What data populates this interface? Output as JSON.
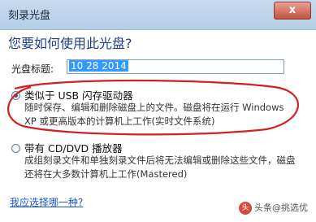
{
  "window": {
    "title": "刻录光盘",
    "close_label": "x"
  },
  "heading": "您要如何使用此光盘?",
  "disc_title": {
    "label": "光盘标题:",
    "value": "10 28 2014"
  },
  "options": [
    {
      "title": "类似于 USB 闪存驱动器",
      "desc_line1": "随时保存、编辑和删除磁盘上的文件。磁盘将在运行 Windows",
      "desc_line2": "XP 或更高版本的计算机上工作(实时文件系统)",
      "selected": true
    },
    {
      "title": "带有 CD/DVD 播放器",
      "desc_line1": "成组刻录文件和单独刻录文件后将无法编辑或删除这些文件，磁盘",
      "desc_line2": "还将在大多数计算机上工作(Mastered)",
      "selected": false
    }
  ],
  "help_link": "我应选择哪一种?",
  "watermark": {
    "text": "头条@挑选优",
    "logo": "头"
  },
  "colors": {
    "heading": "#1f3f86",
    "link": "#1a57c2",
    "annotation": "#d31f1f",
    "selection": "#3399ff"
  }
}
